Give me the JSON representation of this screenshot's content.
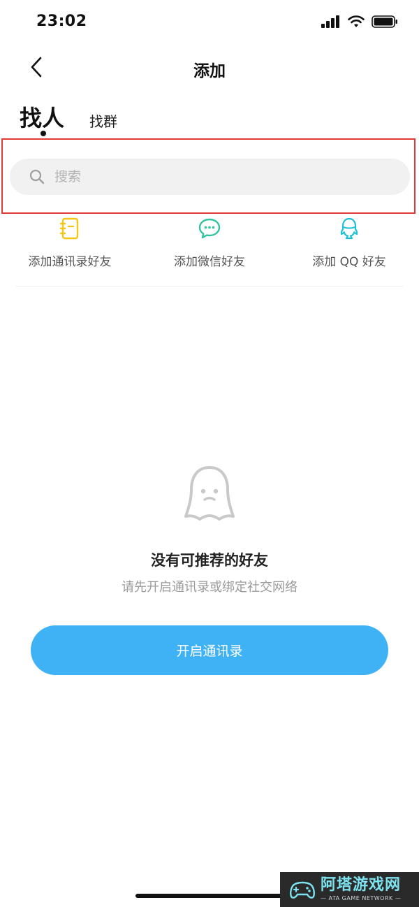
{
  "status_bar": {
    "time": "23:02"
  },
  "nav": {
    "title": "添加"
  },
  "tabs": [
    {
      "label": "找人",
      "active": true
    },
    {
      "label": "找群",
      "active": false
    }
  ],
  "search": {
    "placeholder": "搜索",
    "value": ""
  },
  "quick_actions": [
    {
      "label": "添加通讯录好友",
      "icon": "contacts-book-icon",
      "color": "#f5c518"
    },
    {
      "label": "添加微信好友",
      "icon": "wechat-icon",
      "color": "#2ec4a0"
    },
    {
      "label": "添加 QQ 好友",
      "icon": "qq-penguin-icon",
      "color": "#1ec0d6"
    }
  ],
  "empty_state": {
    "icon": "ghost-icon",
    "title": "没有可推荐的好友",
    "subtitle": "请先开启通讯录或绑定社交网络"
  },
  "primary_button": {
    "label": "开启通讯录",
    "color": "#3fb2f5"
  },
  "watermark": {
    "title": "阿塔游戏网",
    "subtitle": "— ATA GAME NETWORK —"
  },
  "colors": {
    "highlight": "#e53935",
    "search_bg": "#f1f1f1"
  }
}
